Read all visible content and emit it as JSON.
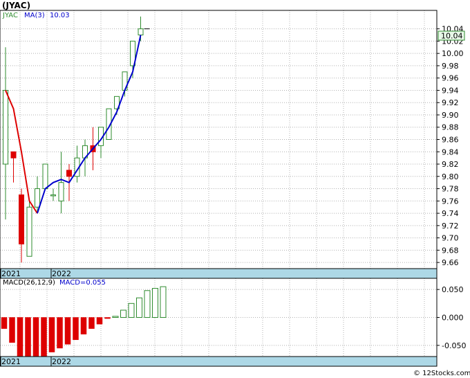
{
  "title": "(JYAC)",
  "watermark": "© 12Stocks.com",
  "colors": {
    "up": "#2e8b2e",
    "down": "#dd0000",
    "ma": "#0000cc",
    "ma_early": "#dd0000",
    "band": "#add8e6",
    "last_box": "#e8f8e8"
  },
  "chart_data": [
    {
      "type": "candlestick",
      "name": "price",
      "legend": {
        "ticker": "JYAC",
        "ma_label": "MA(3)",
        "ma_value": "10.03"
      },
      "last_price": "10.04",
      "ylim": [
        9.65,
        10.07
      ],
      "y_ticks": [
        "10.04",
        "10.02",
        "10.00",
        "9.98",
        "9.96",
        "9.94",
        "9.92",
        "9.90",
        "9.88",
        "9.86",
        "9.84",
        "9.82",
        "9.80",
        "9.78",
        "9.76",
        "9.74",
        "9.72",
        "9.70",
        "9.68",
        "9.66"
      ],
      "year_labels": [
        {
          "label": "2021",
          "index": 0
        },
        {
          "label": "2022",
          "index": 7
        }
      ],
      "grid": true,
      "candles": [
        {
          "o": 9.82,
          "h": 10.01,
          "l": 9.73,
          "c": 9.94
        },
        {
          "o": 9.84,
          "h": 9.84,
          "l": 9.79,
          "c": 9.83
        },
        {
          "o": 9.77,
          "h": 9.78,
          "l": 9.66,
          "c": 9.69
        },
        {
          "o": 9.67,
          "h": 9.76,
          "l": 9.67,
          "c": 9.75
        },
        {
          "o": 9.75,
          "h": 9.8,
          "l": 9.74,
          "c": 9.78
        },
        {
          "o": 9.78,
          "h": 9.82,
          "l": 9.78,
          "c": 9.82
        },
        {
          "o": 9.77,
          "h": 9.78,
          "l": 9.76,
          "c": 9.77
        },
        {
          "o": 9.76,
          "h": 9.84,
          "l": 9.74,
          "c": 9.79
        },
        {
          "o": 9.81,
          "h": 9.82,
          "l": 9.76,
          "c": 9.8
        },
        {
          "o": 9.8,
          "h": 9.85,
          "l": 9.79,
          "c": 9.83
        },
        {
          "o": 9.83,
          "h": 9.86,
          "l": 9.8,
          "c": 9.85
        },
        {
          "o": 9.85,
          "h": 9.88,
          "l": 9.81,
          "c": 9.84
        },
        {
          "o": 9.85,
          "h": 9.87,
          "l": 9.83,
          "c": 9.88
        },
        {
          "o": 9.86,
          "h": 9.91,
          "l": 9.86,
          "c": 9.91
        },
        {
          "o": 9.91,
          "h": 9.93,
          "l": 9.9,
          "c": 9.93
        },
        {
          "o": 9.94,
          "h": 9.97,
          "l": 9.93,
          "c": 9.97
        },
        {
          "o": 9.98,
          "h": 10.02,
          "l": 9.96,
          "c": 10.02
        },
        {
          "o": 10.03,
          "h": 10.06,
          "l": 10.02,
          "c": 10.04
        }
      ],
      "ma3": [
        9.94,
        9.91,
        9.84,
        9.76,
        9.74,
        9.78,
        9.79,
        9.795,
        9.79,
        9.81,
        9.83,
        9.845,
        9.86,
        9.88,
        9.905,
        9.94,
        9.97,
        10.03
      ]
    },
    {
      "type": "bar",
      "name": "macd",
      "legend": {
        "label": "MACD(26,12,9)",
        "value_label": "MACD=0.055"
      },
      "ylim": [
        -0.07,
        0.07
      ],
      "y_ticks": [
        "0.050",
        "0.000",
        "-0.050"
      ],
      "year_labels": [
        {
          "label": "2021",
          "index": 0
        },
        {
          "label": "2022",
          "index": 7
        }
      ],
      "values": [
        -0.02,
        -0.045,
        -0.07,
        -0.078,
        -0.077,
        -0.07,
        -0.062,
        -0.055,
        -0.048,
        -0.04,
        -0.03,
        -0.02,
        -0.012,
        -0.002,
        0.002,
        0.013,
        0.025,
        0.035,
        0.048,
        0.052,
        0.055
      ]
    }
  ]
}
